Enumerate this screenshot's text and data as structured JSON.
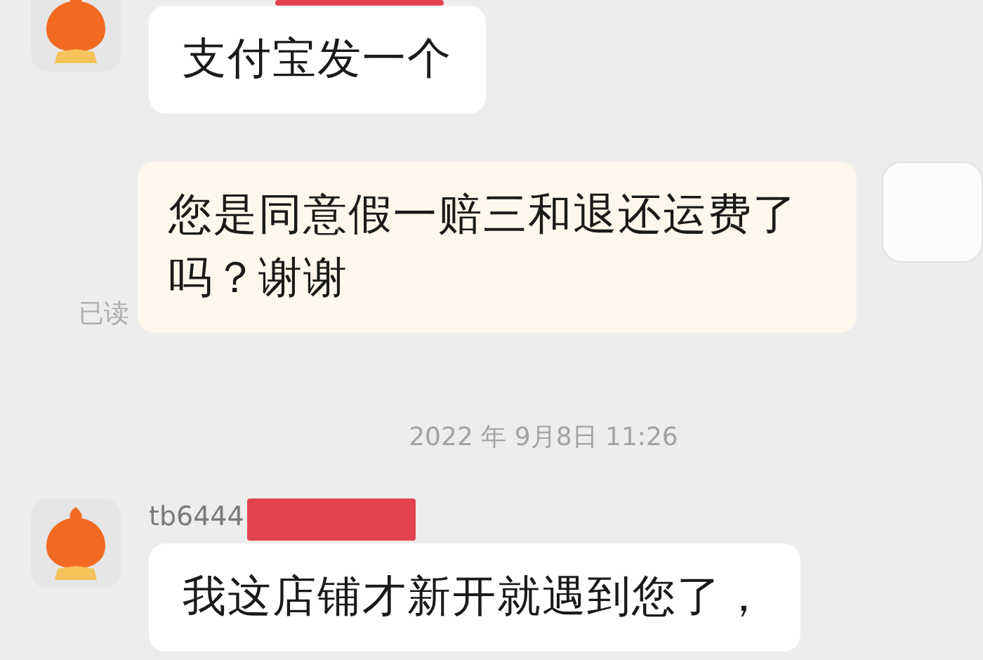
{
  "messages": [
    {
      "kind": "incoming",
      "text": "支付宝发一个",
      "redacted_name": true
    },
    {
      "kind": "outgoing",
      "text": "您是同意假一赔三和退还运费了吗？谢谢",
      "receipt": "已读"
    },
    {
      "kind": "timestamp",
      "text": "2022 年 9月8日 11:26"
    },
    {
      "kind": "incoming",
      "sender": "tb6444",
      "text": "我这店铺才新开就遇到您了，",
      "redacted_name": true
    }
  ]
}
